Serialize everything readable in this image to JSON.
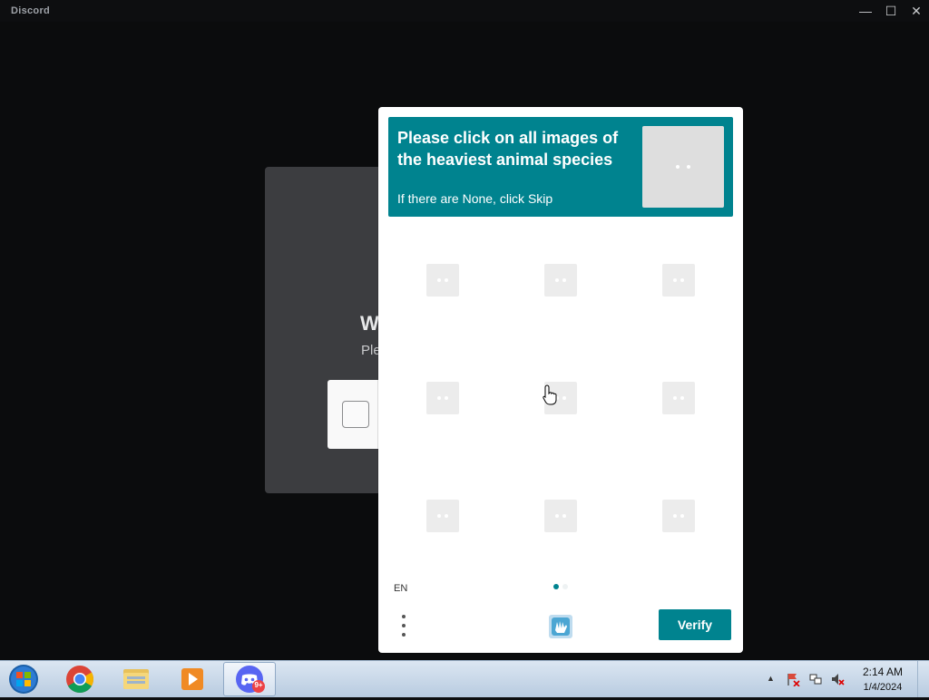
{
  "window": {
    "app_title": "Discord",
    "controls": {
      "minimize": "—",
      "maximize": "☐",
      "close": "✕"
    }
  },
  "background": {
    "title_fragment": "W",
    "subtitle_fragment": "Ple"
  },
  "captcha": {
    "prompt_text": "Please click on all images of the heaviest animal species",
    "hint": "If there are None, click Skip",
    "language": "EN",
    "verify_label": "Verify",
    "grid_rows": 3,
    "grid_cols": 3,
    "accent_color": "#00838f",
    "pages_total": 2,
    "page_current": 1
  },
  "taskbar": {
    "apps": [
      "windows-start",
      "chrome",
      "file-explorer",
      "media-player",
      "discord"
    ],
    "discord_badge": "9+",
    "time": "2:14 AM",
    "date": "1/4/2024"
  }
}
